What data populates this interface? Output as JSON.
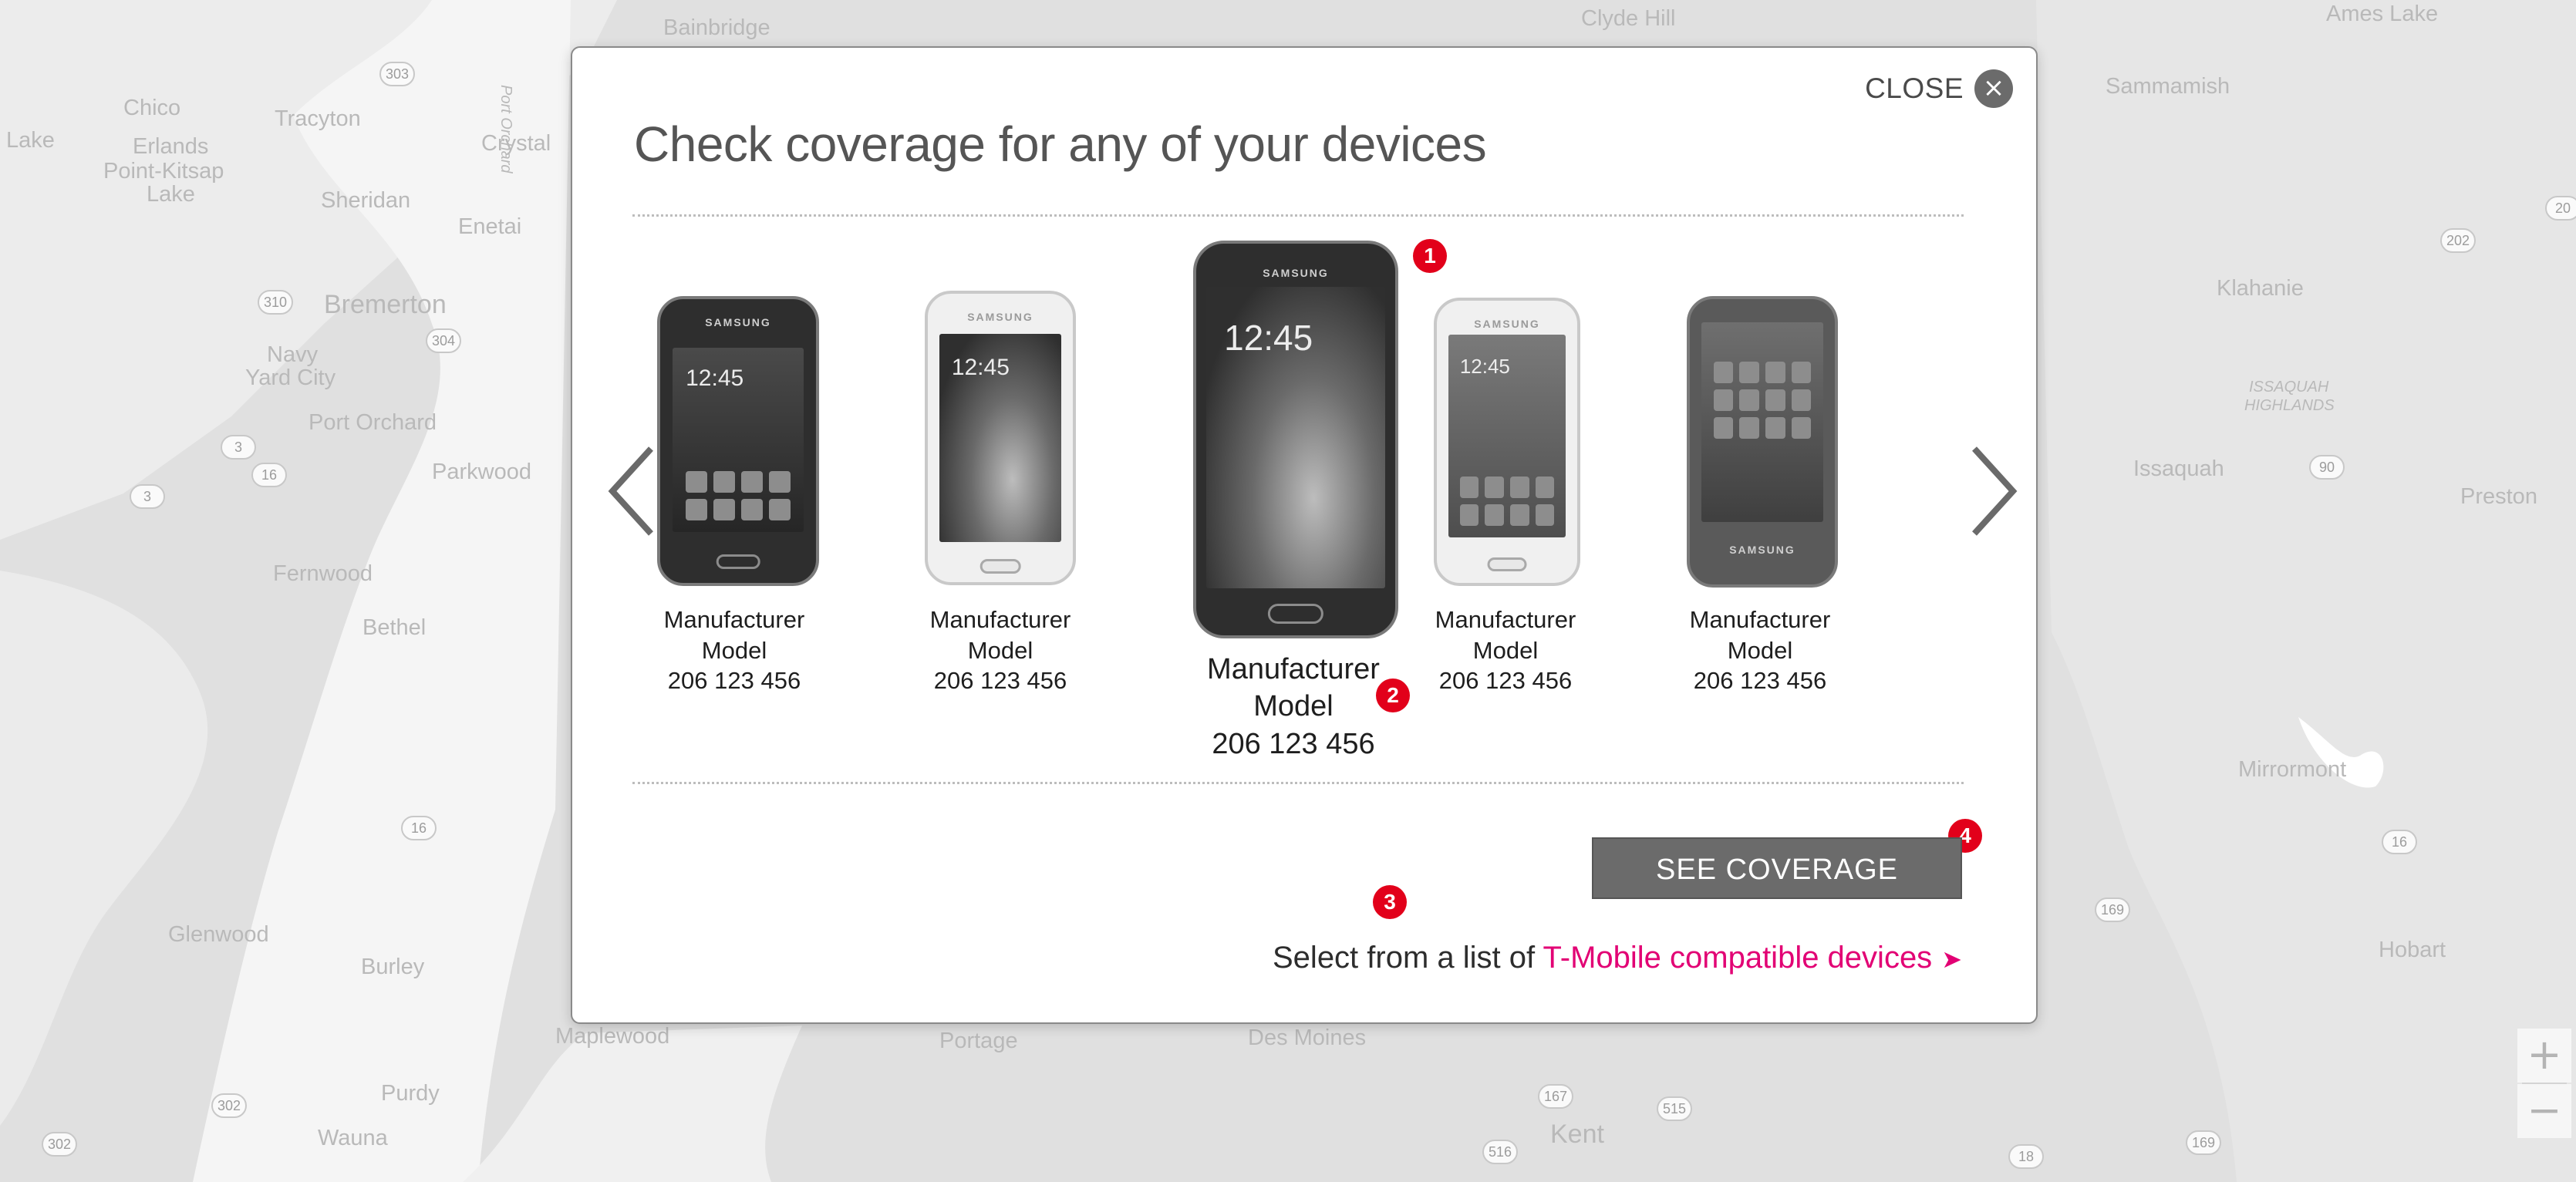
{
  "modal": {
    "title": "Check coverage for any of your devices",
    "close_label": "CLOSE",
    "close_icon": "close-icon",
    "prev_icon": "chevron-left-icon",
    "next_icon": "chevron-right-icon",
    "devices": [
      {
        "manufacturer": "Manufacturer",
        "model": "Model",
        "number": "206 123 456",
        "screen_time": "12:45",
        "brand": "SAMSUNG",
        "style": "dark",
        "selected": false
      },
      {
        "manufacturer": "Manufacturer",
        "model": "Model",
        "number": "206 123 456",
        "screen_time": "12:45",
        "brand": "SAMSUNG",
        "style": "white",
        "selected": false
      },
      {
        "manufacturer": "Manufacturer",
        "model": "Model",
        "number": "206 123 456",
        "screen_time": "12:45",
        "brand": "SAMSUNG",
        "style": "dark",
        "selected": true
      },
      {
        "manufacturer": "Manufacturer",
        "model": "Model",
        "number": "206 123 456",
        "screen_time": "12:45",
        "brand": "SAMSUNG",
        "style": "white",
        "selected": false
      },
      {
        "manufacturer": "Manufacturer",
        "model": "Model",
        "number": "206 123 456",
        "screen_time": "",
        "brand": "SAMSUNG",
        "style": "dark",
        "selected": false
      }
    ],
    "see_coverage_label": "SEE COVERAGE",
    "select_prefix": "Select from a list of ",
    "select_link": "T-Mobile compatible devices",
    "select_arrow": "➤",
    "badges": [
      "1",
      "2",
      "3",
      "4"
    ],
    "accent_color": "#e20074",
    "badge_color": "#e2001a"
  },
  "map": {
    "zoom_in": "+",
    "zoom_out": "−",
    "places": [
      "Bainbridge",
      "Clyde Hill",
      "Ames Lake",
      "Sammamish",
      "Chico",
      "Tracyton",
      "Crystal",
      "Lake",
      "Erlands",
      "Point-Kitsap",
      "Lake",
      "Sheridan",
      "Enetai",
      "Port Orchard",
      "Bremerton",
      "Navy",
      "Yard City",
      "Port Orchard",
      "Parkwood",
      "Fernwood",
      "Bethel",
      "Glenwood",
      "Burley",
      "Purdy",
      "Wauna",
      "Maplewood",
      "Portage",
      "Des Moines",
      "Kent",
      "Klahanie",
      "ISSAQUAH",
      "HIGHLANDS",
      "Issaquah",
      "Preston",
      "Mirrormont",
      "Hobart"
    ],
    "shields": [
      "303",
      "310",
      "304",
      "3",
      "16",
      "3",
      "16",
      "16",
      "302",
      "302",
      "167",
      "515",
      "516",
      "18",
      "169",
      "169",
      "202",
      "90",
      "18",
      "20"
    ]
  }
}
